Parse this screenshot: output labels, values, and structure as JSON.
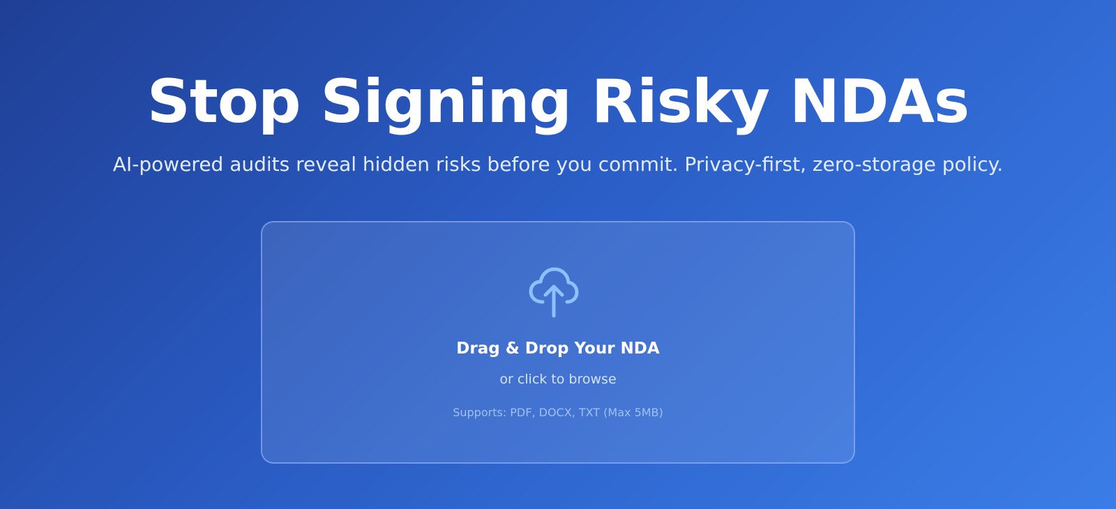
{
  "hero": {
    "headline": "Stop Signing Risky NDAs",
    "subheadline": "AI-powered audits reveal hidden risks before you commit. Privacy-first, zero-storage policy."
  },
  "dropzone": {
    "icon": "cloud-upload-icon",
    "title": "Drag & Drop Your NDA",
    "subtitle": "or click to browse",
    "note": "Supports: PDF, DOCX, TXT (Max 5MB)"
  },
  "colors": {
    "gradient_start": "#1f3f95",
    "gradient_mid": "#2a5cc4",
    "gradient_end": "#3b7de8",
    "icon_color": "#8ec0ff",
    "dropzone_border": "#a0beff",
    "note_color": "#9fc1f5"
  }
}
